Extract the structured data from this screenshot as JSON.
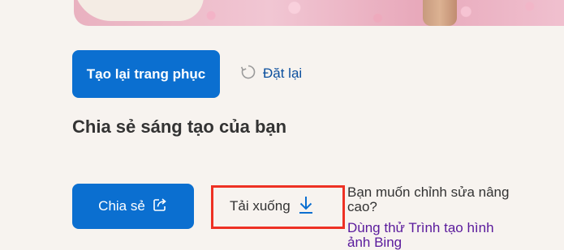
{
  "actions": {
    "regenerate_label": "Tạo lại trang phục",
    "reset_label": "Đặt lại"
  },
  "share_section": {
    "title": "Chia sẻ sáng tạo của bạn",
    "share_label": "Chia sẻ",
    "download_label": "Tải xuống",
    "advanced_question": "Bạn muốn chỉnh sửa nâng cao?",
    "advanced_link": "Dùng thử Trình tạo hình ảnh Bing"
  },
  "highlight": {
    "color": "#ee3124",
    "target": "download-button"
  },
  "colors": {
    "primary": "#0b6fd0",
    "link": "#5a1a9c",
    "reset_text": "#0b4f9e"
  },
  "icons": {
    "reset": "reset-icon",
    "share": "share-icon",
    "download": "download-arrow-icon"
  }
}
